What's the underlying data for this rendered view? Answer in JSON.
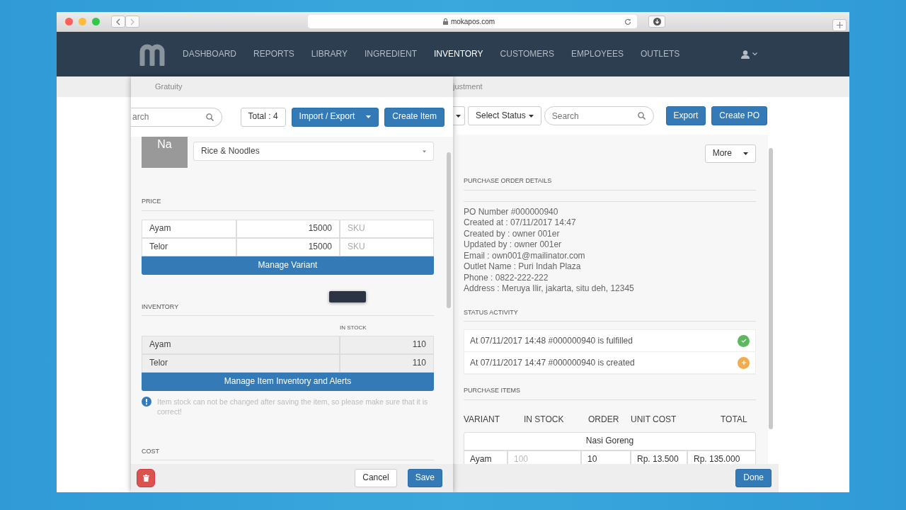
{
  "browser": {
    "url": "mokapos.com"
  },
  "nav": {
    "items": [
      {
        "label": "DASHBOARD",
        "selected": false
      },
      {
        "label": "REPORTS",
        "selected": false
      },
      {
        "label": "LIBRARY",
        "selected": false
      },
      {
        "label": "INGREDIENT",
        "selected": false
      },
      {
        "label": "INVENTORY",
        "selected": true
      },
      {
        "label": "CUSTOMERS",
        "selected": false
      },
      {
        "label": "EMPLOYEES",
        "selected": false
      },
      {
        "label": "OUTLETS",
        "selected": false
      }
    ]
  },
  "purchase_order_page": {
    "tab_fragment": "justment",
    "status_filter": "Select Status",
    "search": {
      "placeholder": "Search"
    },
    "buttons": [
      "Export",
      "Create PO"
    ],
    "more_button": "More",
    "details_heading": "PURCHASE ORDER DETAILS",
    "details": [
      "PO Number #000000940",
      "Created at : 07/11/2017 14:47",
      "Created by : owner 001er",
      "Updated by : owner 001er",
      "Email : own001@mailinator.com",
      "Outlet Name : Puri Indah Plaza",
      "Phone : 0822-222-222",
      "Address : Meruya Ilir, jakarta, situ deh, 12345"
    ],
    "activity_heading": "STATUS ACTIVITY",
    "activity": [
      {
        "text": "At 07/11/2017 14:48 #000000940 is fulfilled",
        "kind": "check",
        "color": "#5cb85c"
      },
      {
        "text": "At 07/11/2017 14:47 #000000940 is created",
        "kind": "plus",
        "color": "#f0ad4e"
      }
    ],
    "items_heading": "PURCHASE ITEMS",
    "items_columns": [
      "VARIANT",
      "IN STOCK",
      "ORDER",
      "UNIT COST",
      "TOTAL"
    ],
    "item_groups": [
      {
        "name": "Nasi Goreng",
        "rows": [
          {
            "variant": "Ayam",
            "in_stock": "100",
            "order": "10",
            "unit_cost": "Rp. 13.500",
            "total": "Rp. 135.000"
          }
        ]
      }
    ],
    "done_button": "Done"
  },
  "item_editor": {
    "tab": "Gratuity",
    "search": {
      "placeholder": "arch"
    },
    "total": "Total : 4",
    "import_export": "Import / Export",
    "create_button": "Create Item",
    "avatar": "Na",
    "category": "Rice & Noodles",
    "price_heading": "PRICE",
    "prices": [
      {
        "variant": "Ayam",
        "price": "15000",
        "sku_placeholder": "SKU"
      },
      {
        "variant": "Telor",
        "price": "15000",
        "sku_placeholder": "SKU"
      }
    ],
    "manage_variant": "Manage Variant",
    "inventory_heading": "INVENTORY",
    "stock_column": "IN STOCK",
    "stock": [
      {
        "variant": "Ayam",
        "in_stock": "110"
      },
      {
        "variant": "Telor",
        "in_stock": "110"
      }
    ],
    "manage_inventory": "Manage Item Inventory and Alerts",
    "note": "Item stock can not be changed after saving the item, so please make sure that it is correct!",
    "cost_heading": "COST",
    "cancel": "Cancel",
    "save": "Save"
  }
}
